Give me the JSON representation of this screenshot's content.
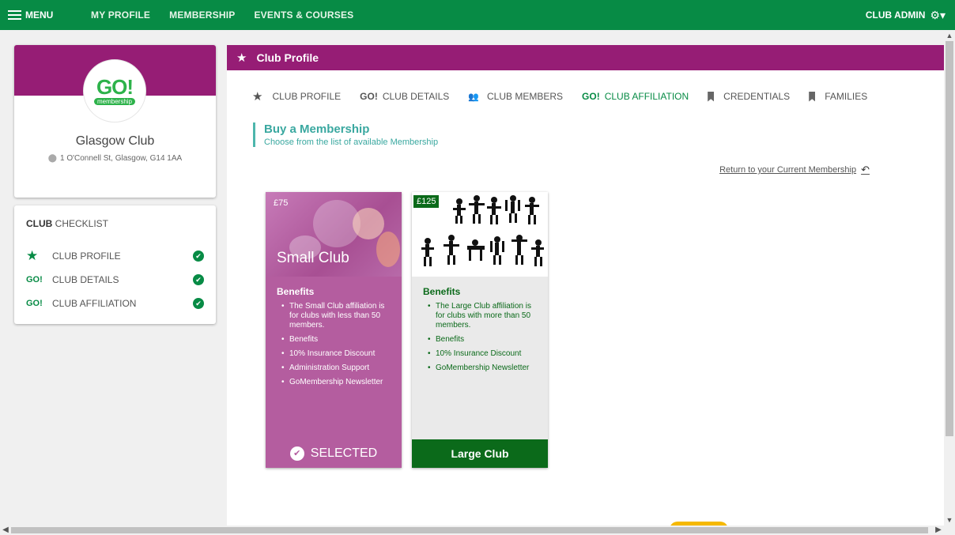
{
  "topnav": {
    "menu_label": "MENU",
    "items": [
      "MY PROFILE",
      "MEMBERSHIP",
      "EVENTS & COURSES"
    ],
    "admin_label": "CLUB ADMIN"
  },
  "club": {
    "logo_text": "GO!",
    "logo_sub": "membership",
    "name": "Glasgow Club",
    "address": "1 O'Connell St, Glasgow, G14 1AA"
  },
  "checklist": {
    "title_bold": "CLUB",
    "title_rest": " CHECKLIST",
    "items": [
      {
        "icon": "★",
        "label": "CLUB PROFILE"
      },
      {
        "icon": "GO!",
        "label": "CLUB DETAILS"
      },
      {
        "icon": "GO!",
        "label": "CLUB AFFILIATION"
      }
    ]
  },
  "main": {
    "header": "Club Profile",
    "tabs": [
      {
        "icon": "★",
        "label": "CLUB PROFILE"
      },
      {
        "icon": "GO!",
        "label": "CLUB DETAILS"
      },
      {
        "icon": "👥",
        "label": "CLUB MEMBERS"
      },
      {
        "icon": "GO!",
        "label": "CLUB AFFILIATION"
      },
      {
        "icon": "",
        "label": "CREDENTIALS"
      },
      {
        "icon": "",
        "label": "FAMILIES"
      }
    ],
    "section_title": "Buy a Membership",
    "section_sub": "Choose from the list of available Membership",
    "return_link": "Return to your Current Membership"
  },
  "plans": {
    "small": {
      "price": "£75",
      "title": "Small Club",
      "benefits_heading": "Benefits",
      "benefits": [
        "The Small Club affiliation is for clubs with less than 50 members.",
        "Benefits",
        "10% Insurance Discount",
        "Administration Support",
        "GoMembership Newsletter"
      ],
      "footer": "SELECTED"
    },
    "large": {
      "price": "£125",
      "benefits_heading": "Benefits",
      "benefits": [
        "The Large Club affiliation is for clubs with more than 50 members.",
        "Benefits",
        "10% Insurance Discount",
        "GoMembership Newsletter"
      ],
      "footer": "Large Club"
    }
  },
  "colors": {
    "nav_green": "#078b45",
    "brand_purple": "#961d75",
    "teal": "#3aa8a0",
    "small_card": "#b45d9f",
    "large_green": "#0b6a1a"
  }
}
